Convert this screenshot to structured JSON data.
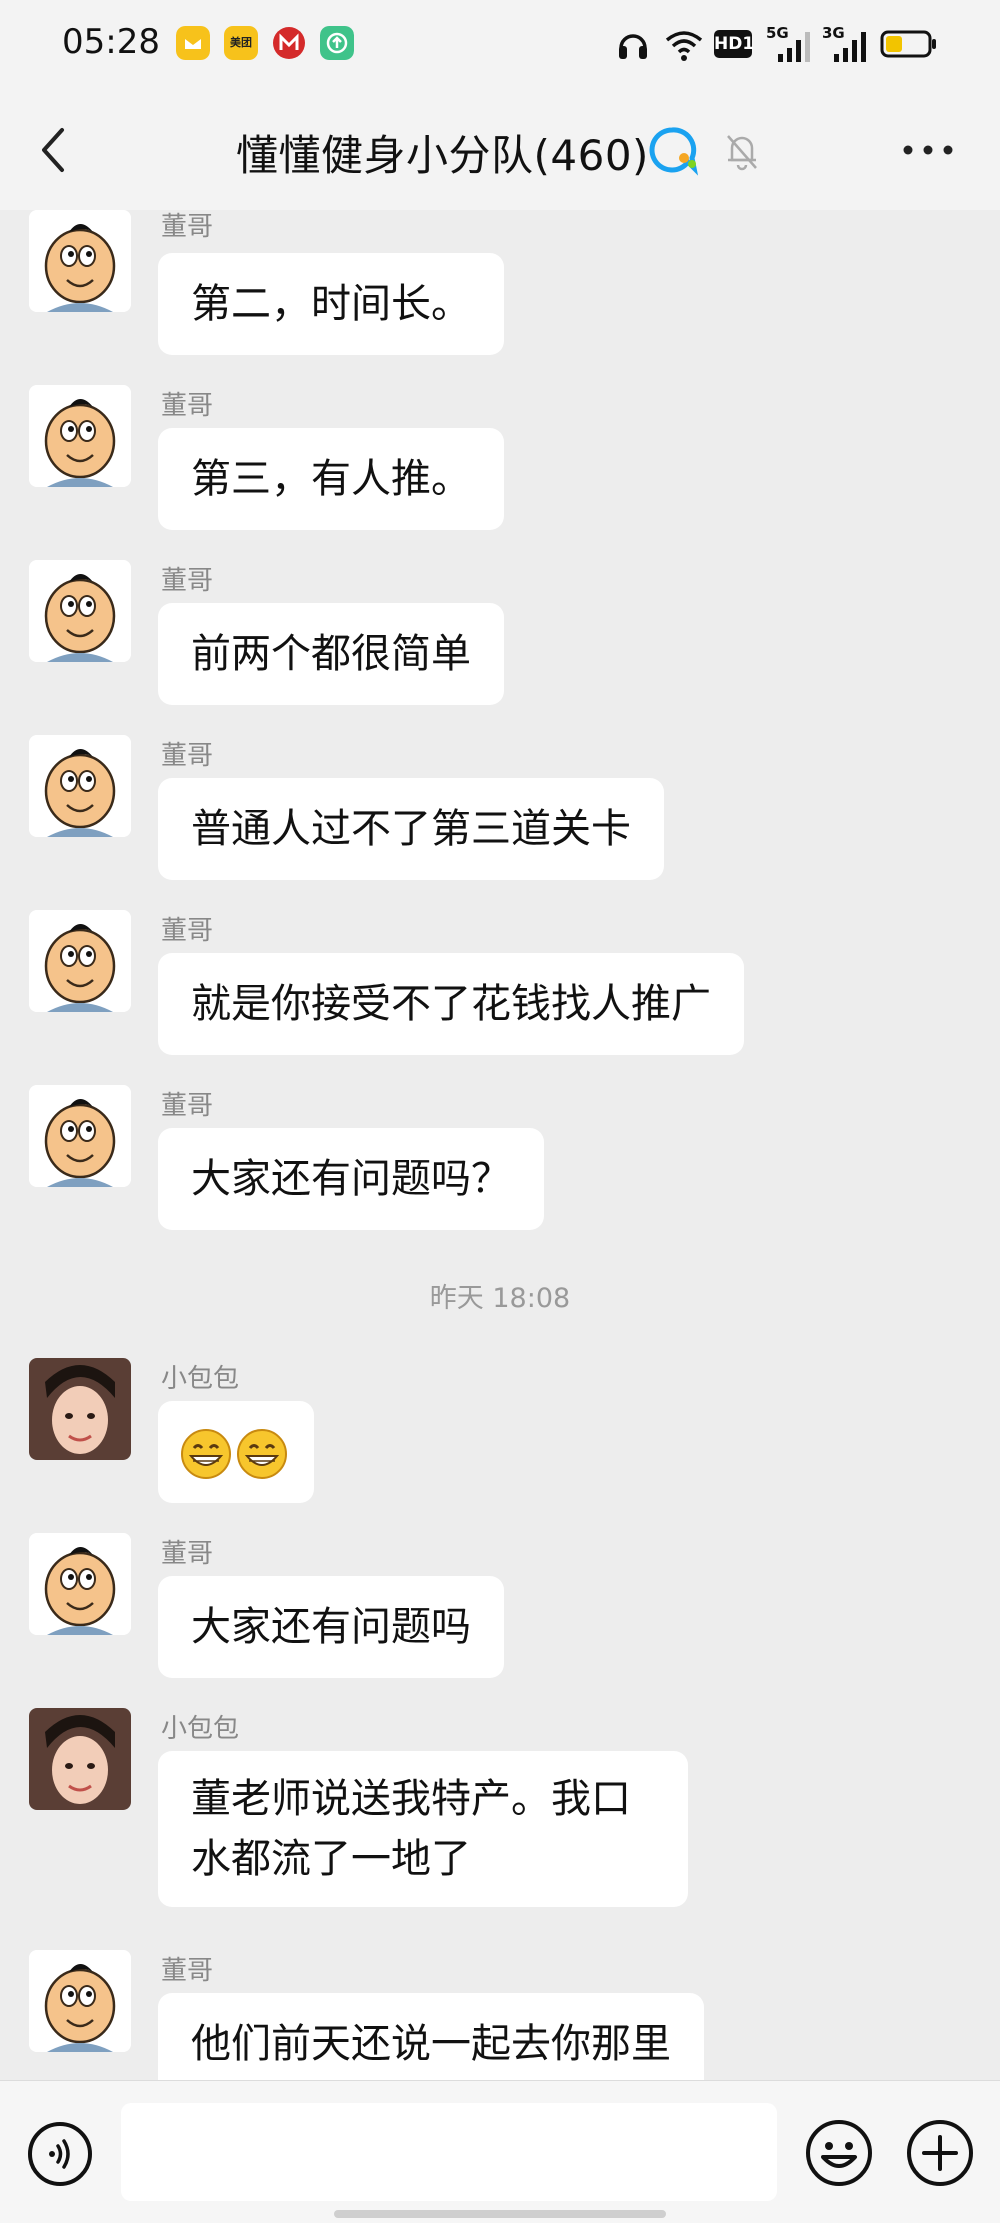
{
  "status_bar": {
    "time": "05:28",
    "app_icons": [
      "notification-yellow-icon",
      "meituan-icon",
      "metro-icon",
      "upload-green-icon"
    ],
    "meituan_label": "美团",
    "indicators": [
      "headphone-icon",
      "wifi-icon",
      "hd-icon",
      "signal-5g-icon",
      "signal-3g-icon",
      "battery-icon"
    ],
    "hd_label": "HD1",
    "net1": "5G",
    "net2": "3G"
  },
  "header": {
    "title": "懂懂健身小分队(460)",
    "back_icon": "chevron-left-icon",
    "badge_icon": "qq-group-icon",
    "mute_icon": "bell-muted-icon",
    "more_icon": "more-dots-icon"
  },
  "messages": [
    {
      "sender": "董哥",
      "text": "第二，时间长。"
    },
    {
      "sender": "董哥",
      "text": "第三，有人推。"
    },
    {
      "sender": "董哥",
      "text": "前两个都很简单"
    },
    {
      "sender": "董哥",
      "text": "普通人过不了第三道关卡"
    },
    {
      "sender": "董哥",
      "text": "就是你接受不了花钱找人推广"
    },
    {
      "sender": "董哥",
      "text": "大家还有问题吗？"
    },
    {
      "timestamp": "昨天 18:08"
    },
    {
      "sender": "小包包",
      "emojis": [
        "grin-emoji",
        "grin-emoji"
      ]
    },
    {
      "sender": "董哥",
      "text": "大家还有问题吗"
    },
    {
      "sender": "小包包",
      "text": "董老师说送我特产。我口水都流了一地了"
    },
    {
      "sender": "董哥",
      "text": "他们前天还说一起去你那里"
    }
  ],
  "input_bar": {
    "voice_icon": "voice-icon",
    "placeholder": "",
    "emoji_icon": "emoji-smile-icon",
    "plus_icon": "plus-icon"
  },
  "colors": {
    "background": "#ededed",
    "bubble": "#ffffff",
    "sender_text": "#888888",
    "accent_blue": "#1aa2f0"
  }
}
